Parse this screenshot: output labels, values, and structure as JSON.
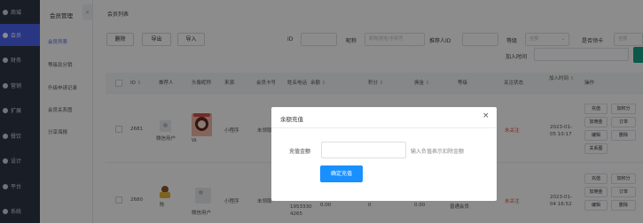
{
  "sidebar": {
    "items": [
      {
        "label": "商城",
        "icon": "shop-icon"
      },
      {
        "label": "会员",
        "icon": "user-icon"
      },
      {
        "label": "财务",
        "icon": "finance-icon"
      },
      {
        "label": "营销",
        "icon": "marketing-icon"
      },
      {
        "label": "扩展",
        "icon": "extend-icon"
      },
      {
        "label": "餐饮",
        "icon": "food-icon"
      },
      {
        "label": "设计",
        "icon": "design-icon"
      },
      {
        "label": "平台",
        "icon": "platform-icon"
      },
      {
        "label": "系统",
        "icon": "system-icon"
      }
    ],
    "active_index": 1,
    "active_color": "#4b63f0"
  },
  "submenu": {
    "title": "会员管理",
    "collapse": "«",
    "items": [
      "会员列表",
      "等级及分销",
      "升级申请记录",
      "会员关系图",
      "分享海报"
    ],
    "active_index": 0
  },
  "main": {
    "breadcrumb": "会员列表",
    "toolbar": {
      "delete": "删除",
      "export": "导出",
      "import": "导入"
    },
    "filters": {
      "id_label": "ID",
      "nickname_label": "昵称",
      "nickname_placeholder": "昵称/姓名/手机号",
      "referrer_label": "推荐人ID",
      "level_label": "等级",
      "level_placeholder": "全部",
      "card_label": "是否领卡",
      "card_placeholder": "全部",
      "join_time_label": "加入时间"
    },
    "columns": [
      "ID",
      "推荐人",
      "头像昵称",
      "来源",
      "会员卡号",
      "姓名电话",
      "余额",
      "积分",
      "佣金",
      "等级",
      "关注状态",
      "加入时间",
      "操作"
    ],
    "rows": [
      {
        "id": "2681",
        "referrer": "",
        "nickname": "微信用户",
        "nickname2": "W.",
        "source": "小程序",
        "card": "未领取",
        "name_phone": "",
        "balance": "",
        "points": "",
        "commission": "",
        "level": "",
        "follow": "未关注",
        "join_time": "2023-01-05 10:17",
        "ops": [
          "充值",
          "加积分",
          "加佣金",
          "订单",
          "编辑",
          "删除",
          "关系图"
        ]
      },
      {
        "id": "2680",
        "referrer": "陈",
        "nickname": "微信用户",
        "source": "小程序",
        "card": "未领取",
        "name_phone": "1953330 4265",
        "balance": "0.00",
        "points": "0",
        "commission": "0.00",
        "level": "普通会员",
        "follow": "未关注",
        "join_time": "2023-01-04 16:52",
        "ops": [
          "充值",
          "加积分",
          "加佣金",
          "订单",
          "编辑",
          "删除"
        ]
      }
    ]
  },
  "dialog": {
    "title": "余额充值",
    "close": "×",
    "amount_label": "充值金额",
    "amount_hint": "输入负值表示扣除金额",
    "confirm": "确定充值",
    "confirm_color": "#1890ff"
  }
}
